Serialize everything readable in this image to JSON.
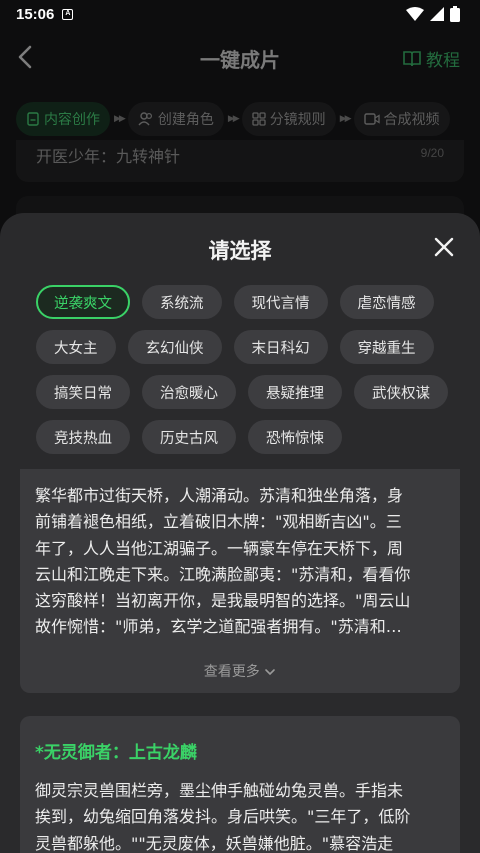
{
  "status_bar": {
    "time": "15:06",
    "notification_glyph": "A",
    "icons": [
      "wifi-icon",
      "signal-icon",
      "battery-icon"
    ]
  },
  "header": {
    "title": "一键成片",
    "tutorial_label": "教程"
  },
  "steps": [
    {
      "label": "内容创作",
      "icon": "document-icon",
      "active": true
    },
    {
      "label": "创建角色",
      "icon": "people-icon",
      "active": false
    },
    {
      "label": "分镜规则",
      "icon": "grid-icon",
      "active": false
    },
    {
      "label": "合成视频",
      "icon": "video-icon",
      "active": false
    }
  ],
  "background_card": {
    "text": "开医少年：九转神针",
    "count": "9/20"
  },
  "sheet": {
    "title": "请选择",
    "genres": [
      [
        "逆袭爽文",
        "系统流",
        "现代言情",
        "虐恋情感"
      ],
      [
        "大女主",
        "玄幻仙侠",
        "末日科幻",
        "穿越重生"
      ],
      [
        "搞笑日常",
        "治愈暖心",
        "悬疑推理",
        "武侠权谋"
      ],
      [
        "竞技热血",
        "历史古风",
        "恐怖惊悚"
      ]
    ],
    "selected_genre": "逆袭爽文"
  },
  "story_cards": [
    {
      "title": "",
      "lines": [
        "繁华都市过街天桥，人潮涌动。苏清和独坐角落，身",
        "前铺着褪色相纸，立着破旧木牌：\"观相断吉凶\"。三",
        "年了，人人当他江湖骗子。一辆豪车停在天桥下，周",
        "云山和江晚走下来。江晚满脸鄙夷：\"苏清和，看看你",
        "这穷酸样！当初离开你，是我最明智的选择。\"周云山",
        "故作惋惜：\"师弟，玄学之道配强者拥有。\"苏清和…"
      ],
      "see_more": "查看更多"
    },
    {
      "title": "*无灵御者：上古龙麟",
      "lines": [
        "御灵宗灵兽围栏旁，墨尘伸手触碰幼兔灵兽。手指未",
        "挨到，幼兔缩回角落发抖。身后哄笑。\"三年了，低阶",
        "灵兽都躲他。\"\"无灵废体，妖兽嫌他脏。\"慕容浩走"
      ]
    }
  ],
  "colors": {
    "accent": "#3ad267",
    "sheet_bg": "#2a2a2c",
    "chip_bg": "#3d3d40",
    "card_bg": "#3a3a3d",
    "page_bg": "#0d0d0e"
  }
}
